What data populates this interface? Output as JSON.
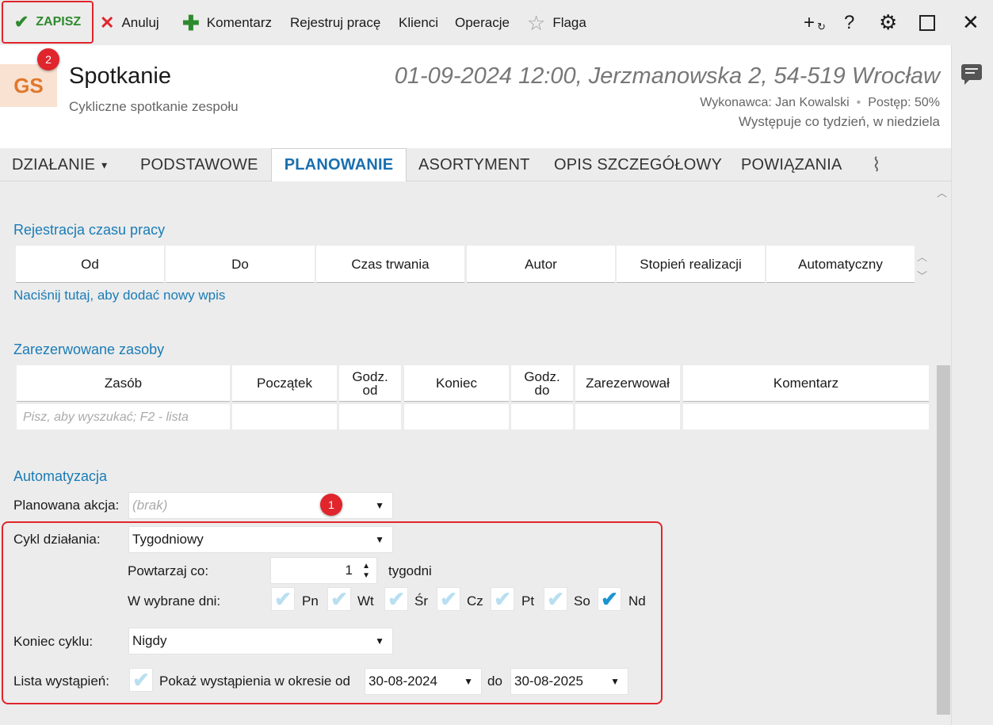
{
  "toolbar": {
    "save_label": "ZAPISZ",
    "cancel_label": "Anuluj",
    "comment_label": "Komentarz",
    "register_label": "Rejestruj pracę",
    "clients_label": "Klienci",
    "operations_label": "Operacje",
    "flag_label": "Flaga",
    "icons": [
      "check-icon",
      "close-icon",
      "plus-icon",
      "star-icon",
      "add-linked-icon",
      "help-icon",
      "gear-icon",
      "maximize-icon",
      "window-close-icon"
    ]
  },
  "badges": {
    "badge_1": "1",
    "badge_2": "2"
  },
  "header": {
    "avatar_initials": "GS",
    "title": "Spotkanie",
    "subtitle": "Cykliczne spotkanie zespołu",
    "datetime_location": "01-09-2024 12:00, Jerzmanowska 2, 54-519 Wrocław",
    "assignee": "Wykonawca: Jan Kowalski",
    "separator": "•",
    "progress": "Postęp: 50%",
    "recurrence": "Występuje co tydzień, w niedziela"
  },
  "tabs": {
    "action": "DZIAŁANIE",
    "basic": "PODSTAWOWE",
    "planning": "PLANOWANIE",
    "assortment": "ASORTYMENT",
    "description": "OPIS SZCZEGÓŁOWY",
    "relations": "POWIĄZANIA",
    "active": "PLANOWANIE"
  },
  "work_time": {
    "title": "Rejestracja czasu pracy",
    "columns": [
      "Od",
      "Do",
      "Czas trwania",
      "Autor",
      "Stopień realizacji",
      "Automatyczny"
    ],
    "add_link": "Naciśnij tutaj, aby dodać nowy wpis"
  },
  "resources": {
    "title": "Zarezerwowane zasoby",
    "col_resource": "Zasób",
    "col_start": "Początek",
    "col_from_1": "Godz.",
    "col_from_2": "od",
    "col_end": "Koniec",
    "col_to_1": "Godz.",
    "col_to_2": "do",
    "col_reserved_by": "Zarezerwował",
    "col_comment": "Komentarz",
    "search_placeholder": "Pisz, aby wyszukać; F2 - lista"
  },
  "automation": {
    "title": "Automatyzacja",
    "planned_action_label": "Planowana akcja:",
    "planned_action_value": "(brak)",
    "cycle_label": "Cykl działania:",
    "cycle_value": "Tygodniowy",
    "repeat_label": "Powtarzaj co:",
    "repeat_value": "1",
    "repeat_unit": "tygodni",
    "days_label": "W wybrane dni:",
    "days": [
      {
        "label": "Pn",
        "checked": false
      },
      {
        "label": "Wt",
        "checked": false
      },
      {
        "label": "Śr",
        "checked": false
      },
      {
        "label": "Cz",
        "checked": false
      },
      {
        "label": "Pt",
        "checked": false
      },
      {
        "label": "So",
        "checked": false
      },
      {
        "label": "Nd",
        "checked": true
      }
    ],
    "cycle_end_label": "Koniec cyklu:",
    "cycle_end_value": "Nigdy",
    "occurrences_label": "Lista wystąpień:",
    "show_occurrences_label": "Pokaż wystąpienia w okresie od",
    "show_occurrences_checked": false,
    "date_from": "30-08-2024",
    "date_to_label": "do",
    "date_to": "30-08-2025"
  },
  "colors": {
    "accent": "#1a7cb6",
    "highlight": "#e0252c",
    "save_green": "#2e8a2e",
    "avatar_bg": "#f9e2d2",
    "avatar_fg": "#e0782c"
  }
}
